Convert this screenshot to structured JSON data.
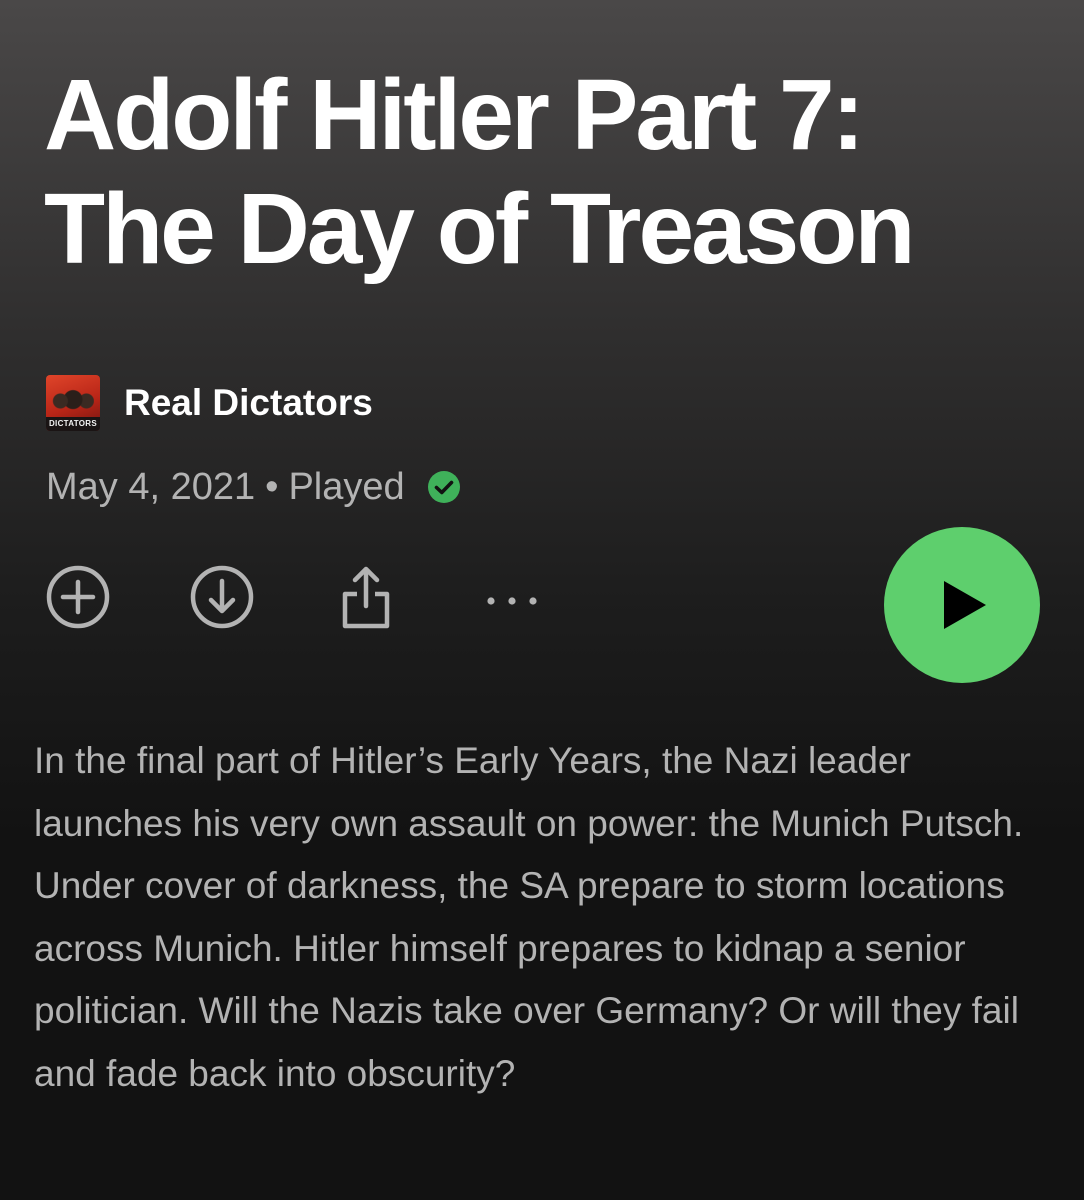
{
  "episode": {
    "title": "Adolf Hitler Part 7: The Day of Treason",
    "date": "May 4, 2021",
    "separator": "•",
    "status": "Played",
    "description": "In the final part of Hitler’s Early Years, the Nazi leader launches his very own assault on power: the Munich Putsch. Under cover of darkness, the SA prepare to storm locations across Munich. Hitler himself prepares to kidnap a senior politician. Will the Nazis take over Germany? Or will they fail and fade back into obscurity?"
  },
  "show": {
    "name": "Real Dictators",
    "art_label": "DICTATORS"
  },
  "actions": {
    "icons": [
      "add-circle-icon",
      "download-icon",
      "share-icon",
      "more-icon"
    ],
    "play_icon": "play-icon"
  },
  "colors": {
    "accent": "#5ecf6d",
    "played_check": "#3fb15a",
    "text_primary": "#ffffff",
    "text_secondary": "#b3b3b3",
    "background": "#121212"
  }
}
